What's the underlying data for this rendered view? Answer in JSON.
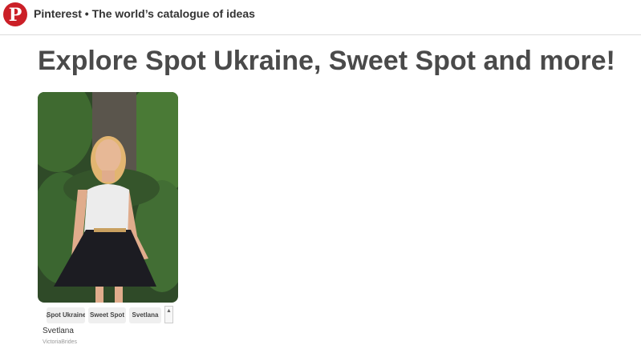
{
  "header": {
    "logo_letter": "P",
    "title": "Pinterest • The world’s catalogue of ideas"
  },
  "headline": "Explore Spot Ukraine, Sweet Spot and more!",
  "pin": {
    "image_icon": "photo-woman-in-white-top-black-skirt",
    "tags": [
      "Spot Ukraine",
      "Sweet Spot",
      "Svetlana"
    ],
    "prev_icon": "chevron-left-icon",
    "scroll_icon": "chevron-up-icon",
    "title": "Svetlana",
    "source": "VictoriaBrides"
  },
  "colors": {
    "brand": "#cb1f27",
    "tag_bg": "#efefef",
    "headline": "#4a4a4a"
  }
}
